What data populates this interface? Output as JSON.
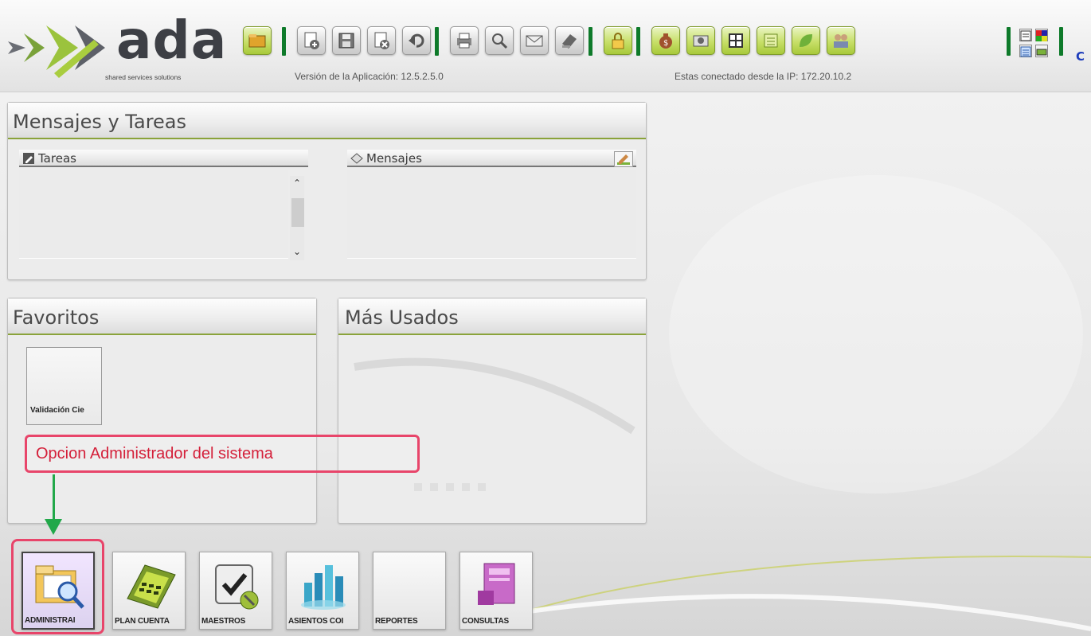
{
  "app": {
    "logo_text": "ada",
    "logo_tagline": "shared services solutions",
    "version_text": "Versión de la Aplicación: 12.5.2.5.0",
    "ip_text": "Estas conectado desde la IP: 172.20.10.2",
    "toolbar_overflow_label": "C",
    "accent_color": "#8aa33a",
    "separator_color": "#0e7a2a"
  },
  "toolbar": {
    "buttons": [
      {
        "icon": "folder-open-icon"
      },
      {
        "icon": "new-record-icon"
      },
      {
        "icon": "save-icon"
      },
      {
        "icon": "delete-icon"
      },
      {
        "icon": "undo-icon"
      },
      {
        "icon": "print-icon"
      },
      {
        "icon": "preview-icon"
      },
      {
        "icon": "mail-icon"
      },
      {
        "icon": "clear-icon"
      },
      {
        "icon": "lock-icon"
      },
      {
        "icon": "money-bag-icon"
      },
      {
        "icon": "camera-icon"
      },
      {
        "icon": "grid-icon"
      },
      {
        "icon": "list-icon"
      },
      {
        "icon": "leaf-icon"
      },
      {
        "icon": "users-icon"
      }
    ],
    "mini_buttons": [
      {
        "icon": "window-icon"
      },
      {
        "icon": "palette-icon"
      },
      {
        "icon": "tree-icon"
      },
      {
        "icon": "battery-icon"
      }
    ]
  },
  "messages_panel": {
    "title": "Mensajes y Tareas",
    "tasks_header": "Tareas",
    "messages_header": "Mensajes"
  },
  "favorites_panel": {
    "title": "Favoritos",
    "items": [
      {
        "label": "Validación Cie"
      }
    ]
  },
  "most_used_panel": {
    "title": "Más Usados"
  },
  "annotation": {
    "text": "Opcion Administrador del sistema",
    "color": "#e8456a",
    "arrow_color": "#22a84a"
  },
  "modules": [
    {
      "label": "ADMINISTRAI",
      "icon": "admin-folder-icon",
      "selected": true
    },
    {
      "label": "PLAN CUENTA",
      "icon": "calculator-icon",
      "selected": false
    },
    {
      "label": "MAESTROS",
      "icon": "checklist-tools-icon",
      "selected": false
    },
    {
      "label": "ASIENTOS COI",
      "icon": "buildings-chart-icon",
      "selected": false
    },
    {
      "label": "REPORTES",
      "icon": "",
      "selected": false
    },
    {
      "label": "CONSULTAS",
      "icon": "purple-report-icon",
      "selected": false
    }
  ]
}
